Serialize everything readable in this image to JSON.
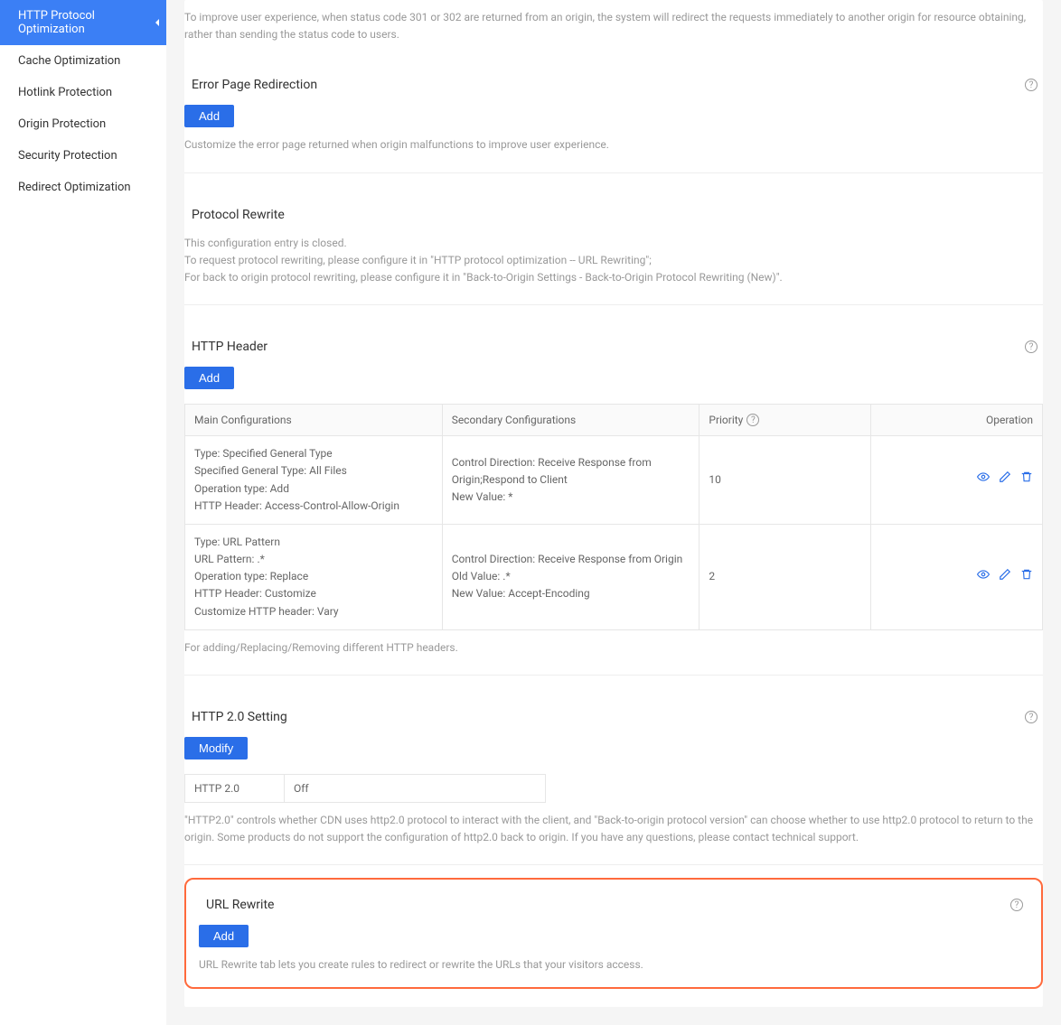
{
  "sidebar": {
    "items": [
      {
        "label": "HTTP Protocol Optimization",
        "active": true
      },
      {
        "label": "Cache Optimization",
        "active": false
      },
      {
        "label": "Hotlink Protection",
        "active": false
      },
      {
        "label": "Origin Protection",
        "active": false
      },
      {
        "label": "Security Protection",
        "active": false
      },
      {
        "label": "Redirect Optimization",
        "active": false
      }
    ]
  },
  "intro": {
    "desc": "To improve user experience, when status code 301 or 302 are returned from an origin, the system will redirect the requests immediately to another origin for resource obtaining, rather than sending the status code to users."
  },
  "errorPage": {
    "title": "Error Page Redirection",
    "button": "Add",
    "desc": "Customize the error page returned when origin malfunctions to improve user experience."
  },
  "protocolRewrite": {
    "title": "Protocol Rewrite",
    "line1": "This configuration entry is closed.",
    "line2": "To request protocol rewriting, please configure it in \"HTTP protocol optimization -- URL Rewriting\";",
    "line3": "For back to origin protocol rewriting, please configure it in \"Back-to-Origin Settings - Back-to-Origin Protocol Rewriting (New)\"."
  },
  "httpHeader": {
    "title": "HTTP Header",
    "button": "Add",
    "columns": {
      "c1": "Main Configurations",
      "c2": "Secondary Configurations",
      "c3": "Priority",
      "c4": "Operation"
    },
    "rows": [
      {
        "main": "Type: Specified General Type\nSpecified General Type: All Files\nOperation type: Add\nHTTP Header: Access-Control-Allow-Origin",
        "secondary": "Control Direction: Receive Response from Origin;Respond to Client\nNew Value: *",
        "priority": "10"
      },
      {
        "main": "Type: URL Pattern\nURL Pattern: .*\nOperation type: Replace\nHTTP Header: Customize\nCustomize HTTP header: Vary",
        "secondary": "Control Direction: Receive Response from Origin\nOld Value: .*\nNew Value: Accept-Encoding",
        "priority": "2"
      }
    ],
    "footer": "For adding/Replacing/Removing different HTTP headers."
  },
  "http2": {
    "title": "HTTP 2.0 Setting",
    "button": "Modify",
    "label": "HTTP 2.0",
    "value": "Off",
    "desc": "\"HTTP2.0\" controls whether CDN uses http2.0 protocol to interact with the client, and \"Back-to-origin protocol version\" can choose whether to use http2.0 protocol to return to the origin. Some products do not support the configuration of http2.0 back to origin. If you have any questions, please contact technical support."
  },
  "urlRewrite": {
    "title": "URL Rewrite",
    "button": "Add",
    "desc": "URL Rewrite tab lets you create rules to redirect or rewrite the URLs that your visitors access."
  },
  "icons": {
    "view": "view-icon",
    "edit": "edit-icon",
    "delete": "delete-icon"
  }
}
